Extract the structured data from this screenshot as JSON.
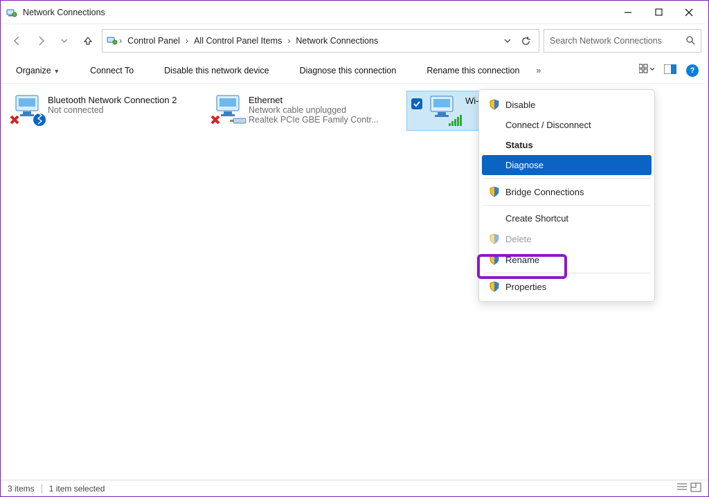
{
  "window": {
    "title": "Network Connections"
  },
  "breadcrumb": {
    "items": [
      "Control Panel",
      "All Control Panel Items",
      "Network Connections"
    ]
  },
  "search": {
    "placeholder": "Search Network Connections"
  },
  "toolbar": {
    "organize": "Organize",
    "connect": "Connect To",
    "disable": "Disable this network device",
    "diagnose": "Diagnose this connection",
    "rename": "Rename this connection",
    "more": "»"
  },
  "connections": [
    {
      "name": "Bluetooth Network Connection 2",
      "status": "Not connected",
      "detail": ""
    },
    {
      "name": "Ethernet",
      "status": "Network cable unplugged",
      "detail": "Realtek PCIe GBE Family Contr..."
    },
    {
      "name": "Wi-Fi",
      "status": "",
      "detail": ""
    }
  ],
  "context_menu": {
    "items": [
      {
        "label": "Disable",
        "shield": true
      },
      {
        "label": "Connect / Disconnect",
        "shield": false
      },
      {
        "label": "Status",
        "bold": true
      },
      {
        "label": "Diagnose",
        "hover": true
      },
      {
        "sep": true
      },
      {
        "label": "Bridge Connections",
        "shield": true
      },
      {
        "sep": true
      },
      {
        "label": "Create Shortcut",
        "shield": false
      },
      {
        "label": "Delete",
        "shield": true,
        "disabled": true
      },
      {
        "label": "Rename",
        "shield": true
      },
      {
        "sep": true
      },
      {
        "label": "Properties",
        "shield": true,
        "highlighted": true
      }
    ]
  },
  "statusbar": {
    "count": "3 items",
    "selected": "1 item selected"
  }
}
